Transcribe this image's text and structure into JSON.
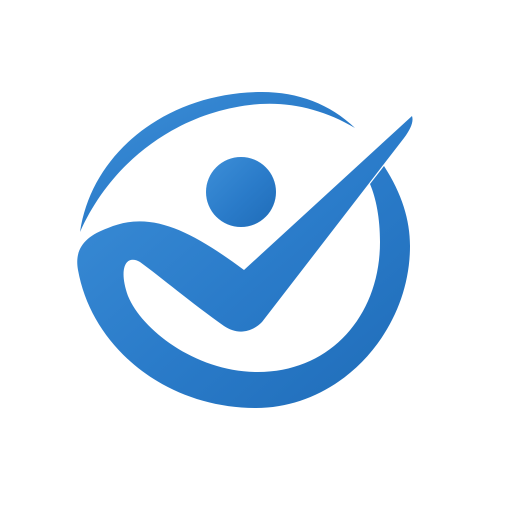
{
  "logo": {
    "icon": "person-check-circle-icon",
    "colors": {
      "primary": "#2a7bc9",
      "light": "#3d8fd8",
      "dark": "#1f6cb8",
      "background": "#ffffff"
    }
  }
}
